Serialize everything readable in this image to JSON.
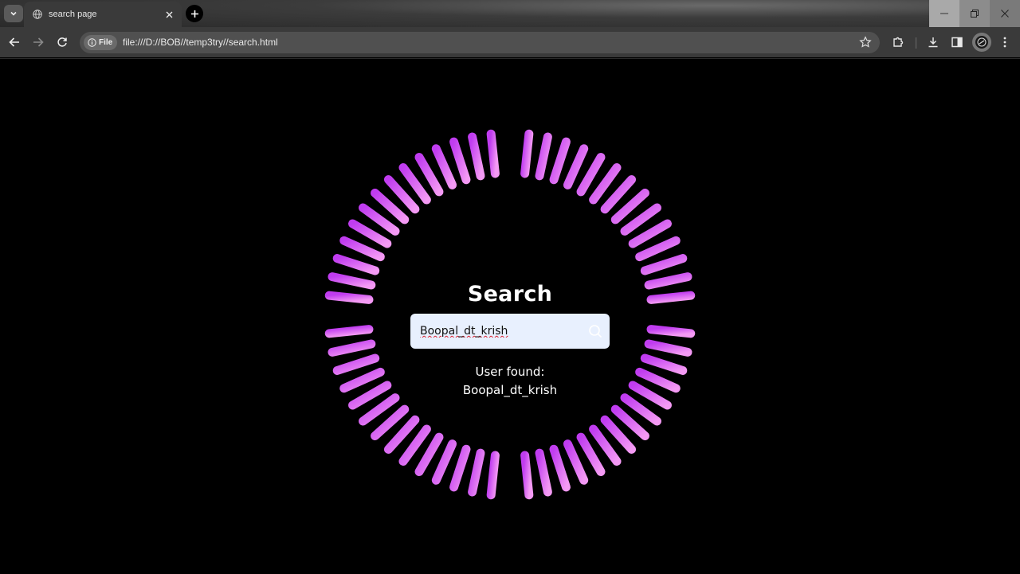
{
  "browser": {
    "tab_title": "search page",
    "url_chip": "File",
    "url": "file:///D://BOB//temp3try//search.html"
  },
  "page": {
    "heading": "Search",
    "search": {
      "value": "Boopal_dt_krish"
    },
    "result": {
      "line1": "User found:",
      "line2": "Boopal_dt_krish"
    }
  },
  "colors": {
    "ring_start": "#c03cf0",
    "ring_end": "#f49af4",
    "input_bg": "#e8f0fe",
    "page_bg": "#000000"
  }
}
